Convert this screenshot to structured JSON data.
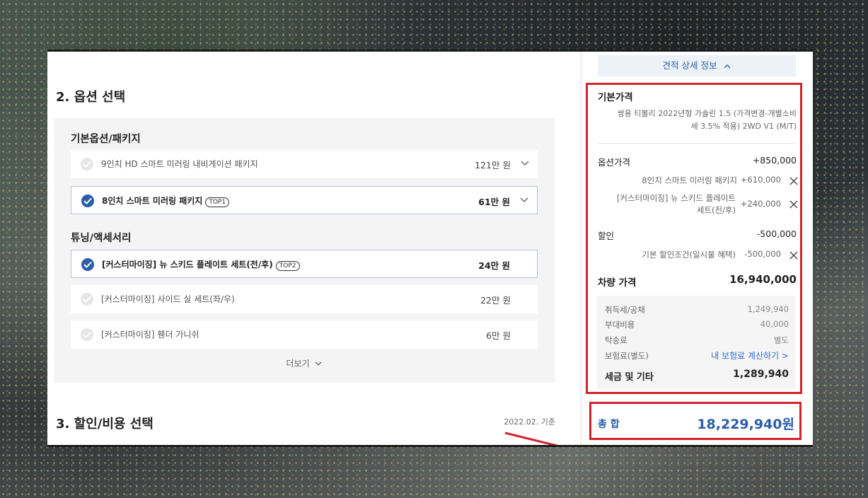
{
  "section2": {
    "title": "2. 옵션 선택",
    "groups": [
      {
        "label": "기본옵션/패키지"
      },
      {
        "label": "튜닝/액세서리"
      }
    ],
    "rows": [
      {
        "label": "9인치 HD 스마트 미러링 내비게이션 패키지",
        "tag": "",
        "price": "121만 원",
        "selected": false
      },
      {
        "label": "8인치 스마트 미러링 패키지",
        "tag": "TOP1",
        "price": "61만 원",
        "selected": true
      },
      {
        "label": "[커스터마이징] 뉴 스키드 플레이트 세트(전/후)",
        "tag": "TOP2",
        "price": "24만 원",
        "selected": true
      },
      {
        "label": "[커스터마이징] 사이드 실 세트(좌/우)",
        "tag": "",
        "price": "22만 원",
        "selected": false
      },
      {
        "label": "[커스터마이징] 휀더 가니쉬",
        "tag": "",
        "price": "6만 원",
        "selected": false
      }
    ],
    "more_label": "더보기"
  },
  "section3": {
    "title": "3. 할인/비용 선택",
    "date": "2022.02. 기준"
  },
  "summary": {
    "detail_button": "견적 상세 정보",
    "base_title": "기본가격",
    "base_desc_1": "쌍용 티볼리 2022년형 가솔린 1.5 (가격변경-개별소비",
    "base_desc_2": "세 3.5% 적용) 2WD V1 (M/T)",
    "option_label": "옵션가격",
    "option_value": "+850,000",
    "option_items": [
      {
        "label": "8인치 스마트 미러링 패키지",
        "value": "+610,000"
      },
      {
        "label_1": "[커스터마이징] 뉴 스키드 플레이트",
        "label_2": "세트(전/후)",
        "value": "+240,000"
      }
    ],
    "discount_label": "할인",
    "discount_value": "-500,000",
    "discount_item_label": "기본 할인조건(일시불 혜택)",
    "discount_item_value": "-500,000",
    "car_price_label": "차량 가격",
    "car_price_value": "16,940,000",
    "tax_rows": [
      {
        "label": "취득세/공채",
        "value": "1,249,940"
      },
      {
        "label": "부대비용",
        "value": "40,000"
      },
      {
        "label": "탁송료",
        "value": "별도"
      },
      {
        "label": "보험료(별도)",
        "value": "내 보험료 계산하기 >"
      }
    ],
    "tax_total_label": "세금 및 기타",
    "tax_total_value": "1,289,940",
    "total_label": "총 합",
    "total_value": "18,229,940원"
  },
  "colors": {
    "accent": "#2a5ea8",
    "highlight": "#d3232d",
    "link": "#2f6fd0"
  }
}
